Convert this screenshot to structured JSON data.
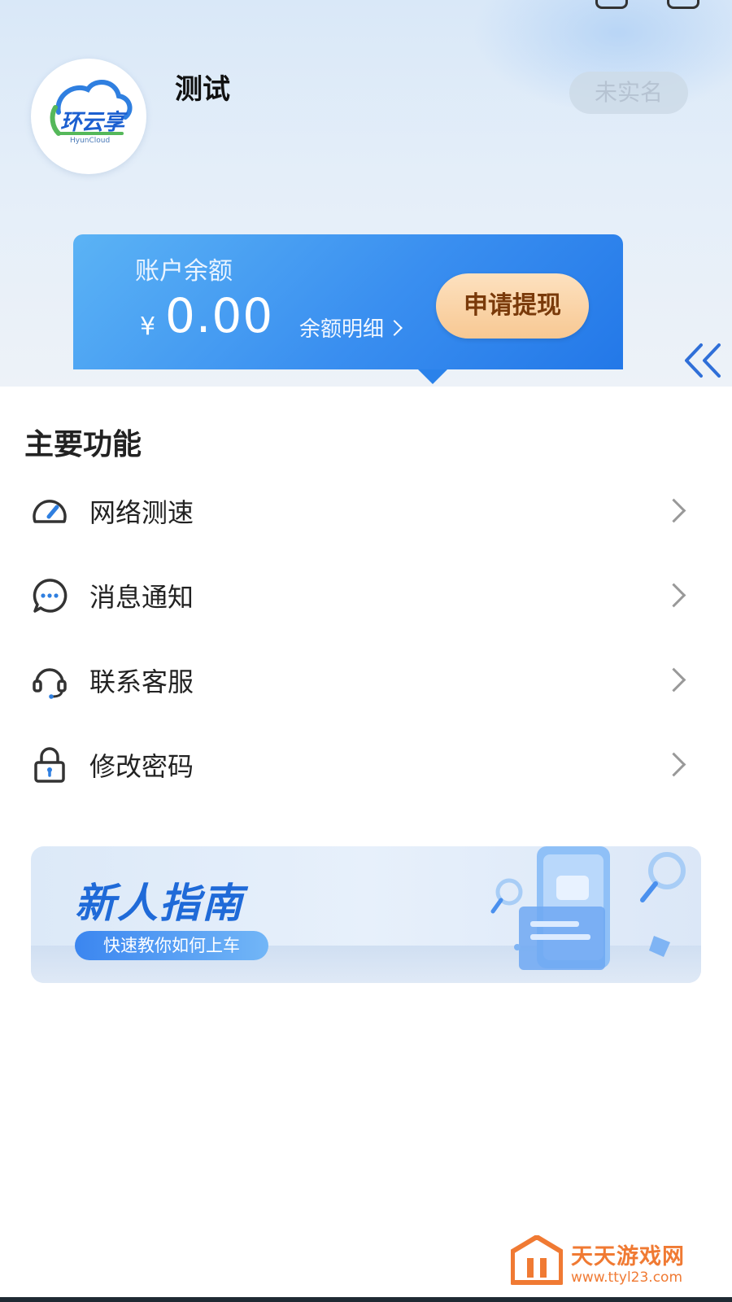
{
  "profile": {
    "logo_text": "环云享",
    "logo_sub": "HyunCloud",
    "username": "测试",
    "verify_status": "未实名"
  },
  "balance": {
    "label": "账户余额",
    "currency": "¥",
    "amount": "0.00",
    "detail_link": "余额明细",
    "withdraw_button": "申请提现"
  },
  "main": {
    "section_title": "主要功能",
    "items": [
      {
        "label": "网络测速",
        "icon": "speedometer-icon"
      },
      {
        "label": "消息通知",
        "icon": "chat-bubble-icon"
      },
      {
        "label": "联系客服",
        "icon": "headset-icon"
      },
      {
        "label": "修改密码",
        "icon": "lock-icon"
      }
    ]
  },
  "guide": {
    "title": "新人指南",
    "subtitle": "快速教你如何上车"
  },
  "watermark": {
    "text": "天天游戏网",
    "url": "www.ttyl23.com"
  },
  "colors": {
    "accent": "#2a82ea",
    "withdraw_bg": "#f7c893",
    "withdraw_text": "#7a3a0a",
    "watermark": "#f07a33"
  }
}
